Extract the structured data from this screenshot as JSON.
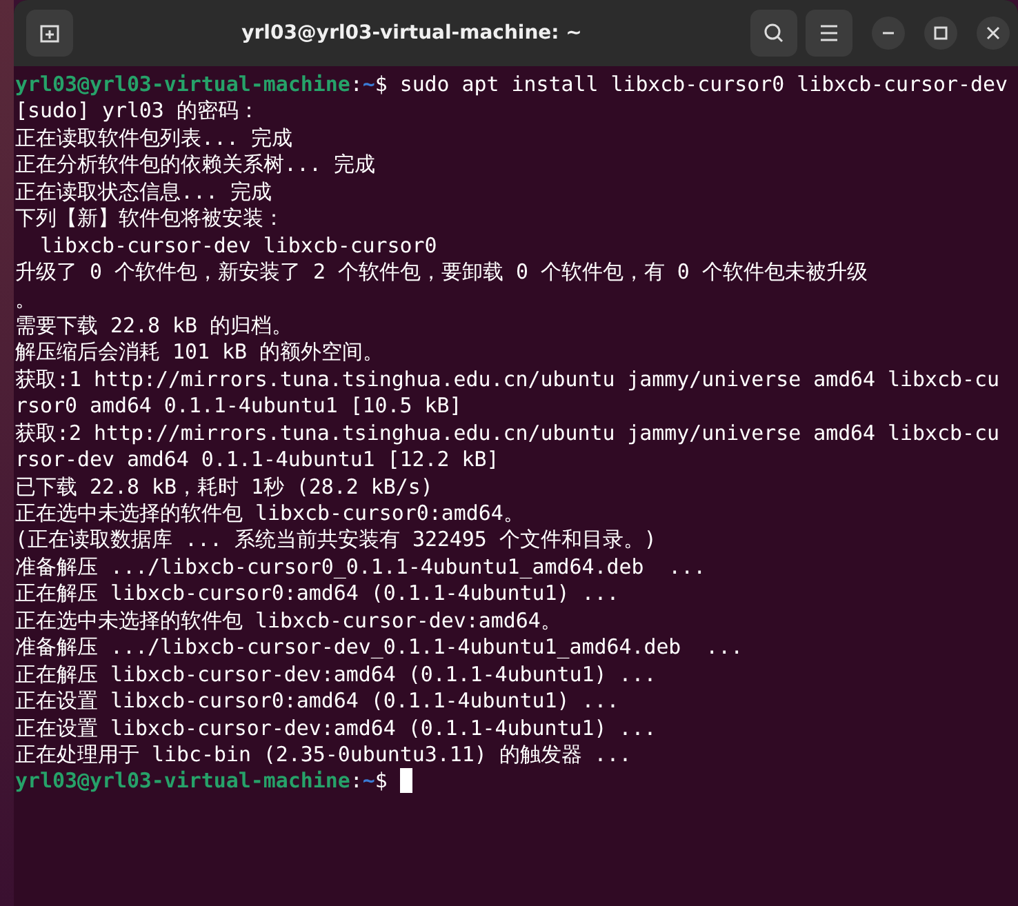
{
  "window": {
    "title": "yrl03@yrl03-virtual-machine: ~"
  },
  "terminal": {
    "lines": [
      {
        "kind": "prompt",
        "user_host": "yrl03@yrl03-virtual-machine",
        "separator": ":",
        "path": "~",
        "symbol": "$",
        "command": "sudo apt install libxcb-cursor0 libxcb-cursor-dev"
      },
      {
        "kind": "output",
        "text": "[sudo] yrl03 的密码："
      },
      {
        "kind": "output",
        "text": "正在读取软件包列表... 完成"
      },
      {
        "kind": "output",
        "text": "正在分析软件包的依赖关系树... 完成"
      },
      {
        "kind": "output",
        "text": "正在读取状态信息... 完成"
      },
      {
        "kind": "output",
        "text": "下列【新】软件包将被安装："
      },
      {
        "kind": "output",
        "text": "  libxcb-cursor-dev libxcb-cursor0"
      },
      {
        "kind": "output",
        "text": "升级了 0 个软件包，新安装了 2 个软件包，要卸载 0 个软件包，有 0 个软件包未被升级"
      },
      {
        "kind": "output",
        "text": "。"
      },
      {
        "kind": "output",
        "text": "需要下载 22.8 kB 的归档。"
      },
      {
        "kind": "output",
        "text": "解压缩后会消耗 101 kB 的额外空间。"
      },
      {
        "kind": "output",
        "text": "获取:1 http://mirrors.tuna.tsinghua.edu.cn/ubuntu jammy/universe amd64 libxcb-cu"
      },
      {
        "kind": "output",
        "text": "rsor0 amd64 0.1.1-4ubuntu1 [10.5 kB]"
      },
      {
        "kind": "output",
        "text": "获取:2 http://mirrors.tuna.tsinghua.edu.cn/ubuntu jammy/universe amd64 libxcb-cu"
      },
      {
        "kind": "output",
        "text": "rsor-dev amd64 0.1.1-4ubuntu1 [12.2 kB]"
      },
      {
        "kind": "output",
        "text": "已下载 22.8 kB，耗时 1秒 (28.2 kB/s)"
      },
      {
        "kind": "output",
        "text": "正在选中未选择的软件包 libxcb-cursor0:amd64。"
      },
      {
        "kind": "output",
        "text": "(正在读取数据库 ... 系统当前共安装有 322495 个文件和目录。)"
      },
      {
        "kind": "output",
        "text": "准备解压 .../libxcb-cursor0_0.1.1-4ubuntu1_amd64.deb  ..."
      },
      {
        "kind": "output",
        "text": "正在解压 libxcb-cursor0:amd64 (0.1.1-4ubuntu1) ..."
      },
      {
        "kind": "output",
        "text": "正在选中未选择的软件包 libxcb-cursor-dev:amd64。"
      },
      {
        "kind": "output",
        "text": "准备解压 .../libxcb-cursor-dev_0.1.1-4ubuntu1_amd64.deb  ..."
      },
      {
        "kind": "output",
        "text": "正在解压 libxcb-cursor-dev:amd64 (0.1.1-4ubuntu1) ..."
      },
      {
        "kind": "output",
        "text": "正在设置 libxcb-cursor0:amd64 (0.1.1-4ubuntu1) ..."
      },
      {
        "kind": "output",
        "text": "正在设置 libxcb-cursor-dev:amd64 (0.1.1-4ubuntu1) ..."
      },
      {
        "kind": "output",
        "text": "正在处理用于 libc-bin (2.35-0ubuntu3.11) 的触发器 ..."
      },
      {
        "kind": "prompt",
        "user_host": "yrl03@yrl03-virtual-machine",
        "separator": ":",
        "path": "~",
        "symbol": "$",
        "cursor": true
      }
    ]
  }
}
